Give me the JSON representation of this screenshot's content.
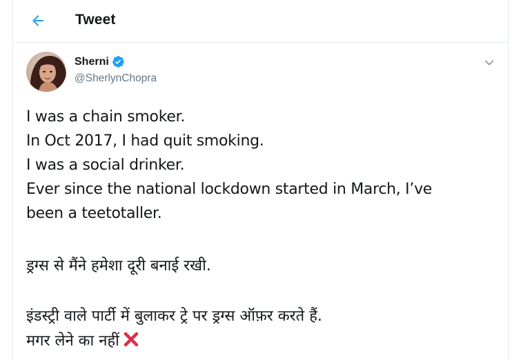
{
  "header": {
    "title": "Tweet",
    "back_icon": "arrow-left-icon",
    "accent_color": "#1da1f2"
  },
  "tweet": {
    "author": {
      "display_name": "Sherni",
      "handle": "@SherlynChopra",
      "verified": true,
      "verified_icon": "verified-badge-icon"
    },
    "menu_icon": "chevron-down-icon",
    "text_lines": [
      "I was a chain smoker.",
      "In Oct 2017, I had quit smoking.",
      "I was a social drinker.",
      "Ever since the national lockdown started in March, I’ve",
      "been a teetotaller."
    ],
    "hindi_paragraph_1": "ड्रग्स से मैंने हमेशा दूरी बनाई रखी.",
    "hindi_paragraph_2_line_1": "इंडस्ट्री वाले पार्टी में बुलाकर ट्रे पर ड्रग्स ऑफ़र करते हैं.",
    "hindi_paragraph_2_line_2": "मगर लेने का नहीं",
    "emoji": "cross-mark-icon"
  }
}
